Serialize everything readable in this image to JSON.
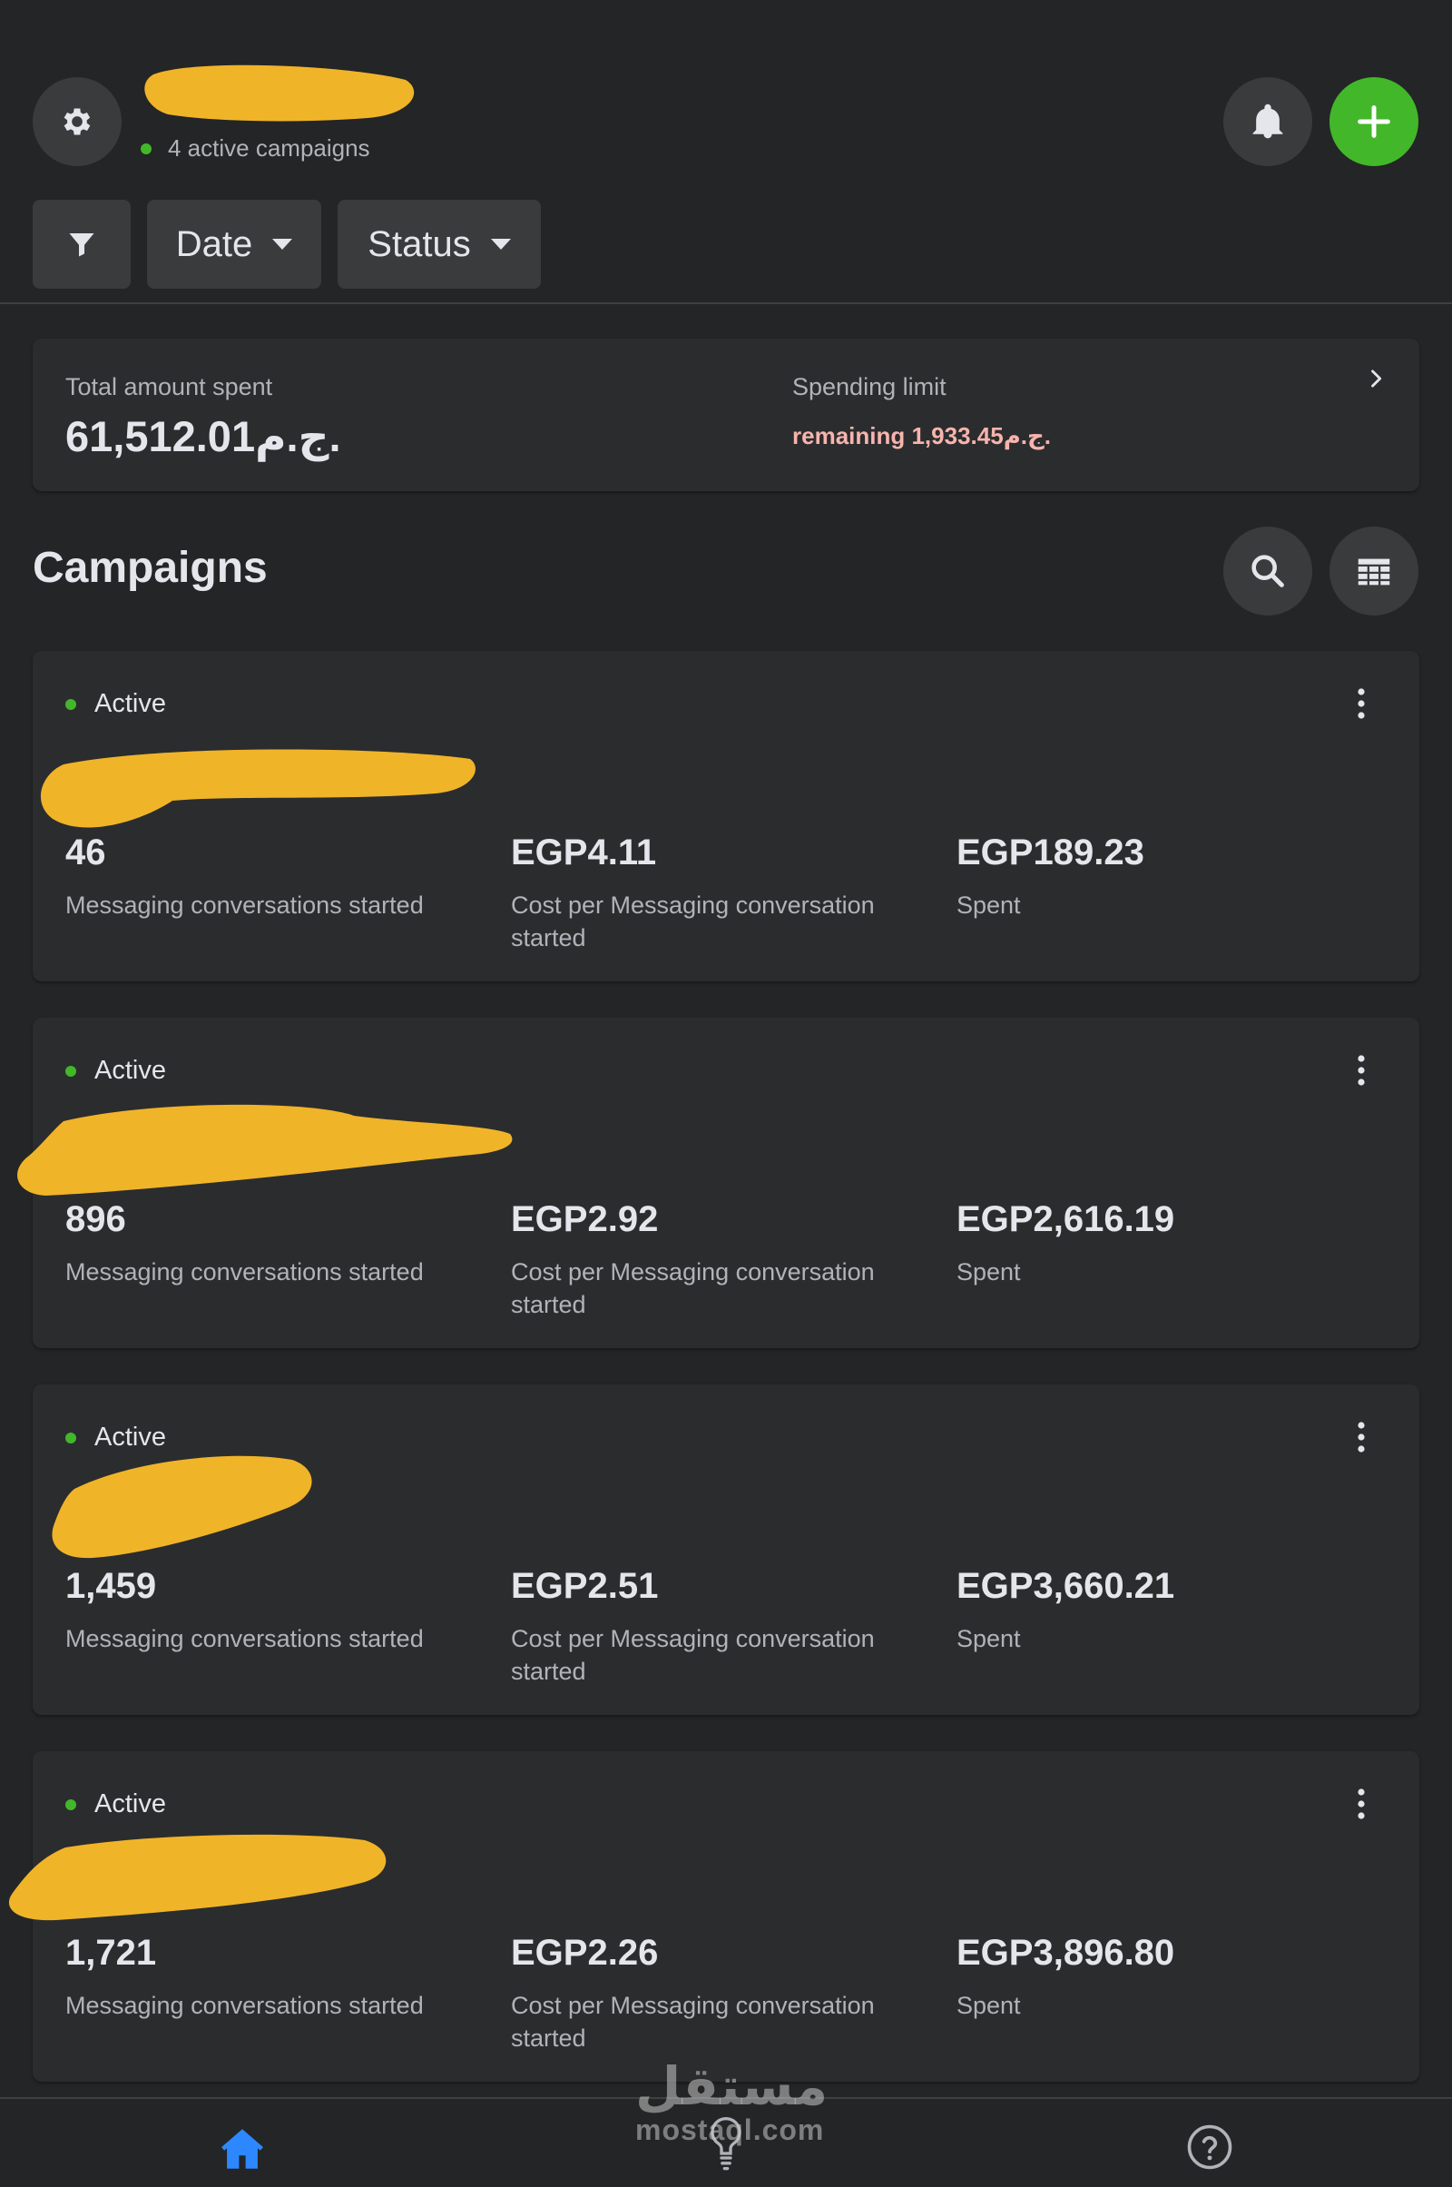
{
  "header": {
    "active_campaigns": "4 active campaigns",
    "icons": {
      "settings": "gear-icon",
      "notifications": "bell-icon",
      "create": "plus-icon"
    }
  },
  "filters": {
    "date_label": "Date",
    "status_label": "Status",
    "icons": {
      "filter": "funnel-icon",
      "caret": "caret-down-icon"
    }
  },
  "summary": {
    "total_label": "Total amount spent",
    "total_value": "61,512.01ج.م.",
    "limit_label": "Spending limit",
    "remaining_text": "remaining 1,933.45ج.م.",
    "icons": {
      "open": "chevron-right-icon"
    }
  },
  "campaigns": {
    "title": "Campaigns",
    "icons": {
      "search": "search-icon",
      "columns": "table-icon",
      "more": "more-vertical-icon"
    },
    "items": [
      {
        "status": "Active",
        "metric1_value": "46",
        "metric1_label": "Messaging conversations started",
        "metric2_value": "EGP4.11",
        "metric2_label": "Cost per Messaging conversation started",
        "metric3_value": "EGP189.23",
        "metric3_label": "Spent"
      },
      {
        "status": "Active",
        "metric1_value": "896",
        "metric1_label": "Messaging conversations started",
        "metric2_value": "EGP2.92",
        "metric2_label": "Cost per Messaging conversation started",
        "metric3_value": "EGP2,616.19",
        "metric3_label": "Spent"
      },
      {
        "status": "Active",
        "metric1_value": "1,459",
        "metric1_label": "Messaging conversations started",
        "metric2_value": "EGP2.51",
        "metric2_label": "Cost per Messaging conversation started",
        "metric3_value": "EGP3,660.21",
        "metric3_label": "Spent"
      },
      {
        "status": "Active",
        "metric1_value": "1,721",
        "metric1_label": "Messaging conversations started",
        "metric2_value": "EGP2.26",
        "metric2_label": "Cost per Messaging conversation started",
        "metric3_value": "EGP3,896.80",
        "metric3_label": "Spent"
      }
    ]
  },
  "bottom_nav": {
    "icons": {
      "home": "home-icon",
      "ideas": "lightbulb-icon",
      "help": "help-icon"
    }
  },
  "watermark": {
    "logo": "مستقل",
    "domain": "mostaql.com"
  },
  "colors": {
    "background": "#242526",
    "card": "#2b2c2e",
    "accent_green": "#42b72a",
    "home_blue": "#2d88ff",
    "remaining_pink": "#f7b4ad",
    "redaction_yellow": "#f0b429"
  }
}
